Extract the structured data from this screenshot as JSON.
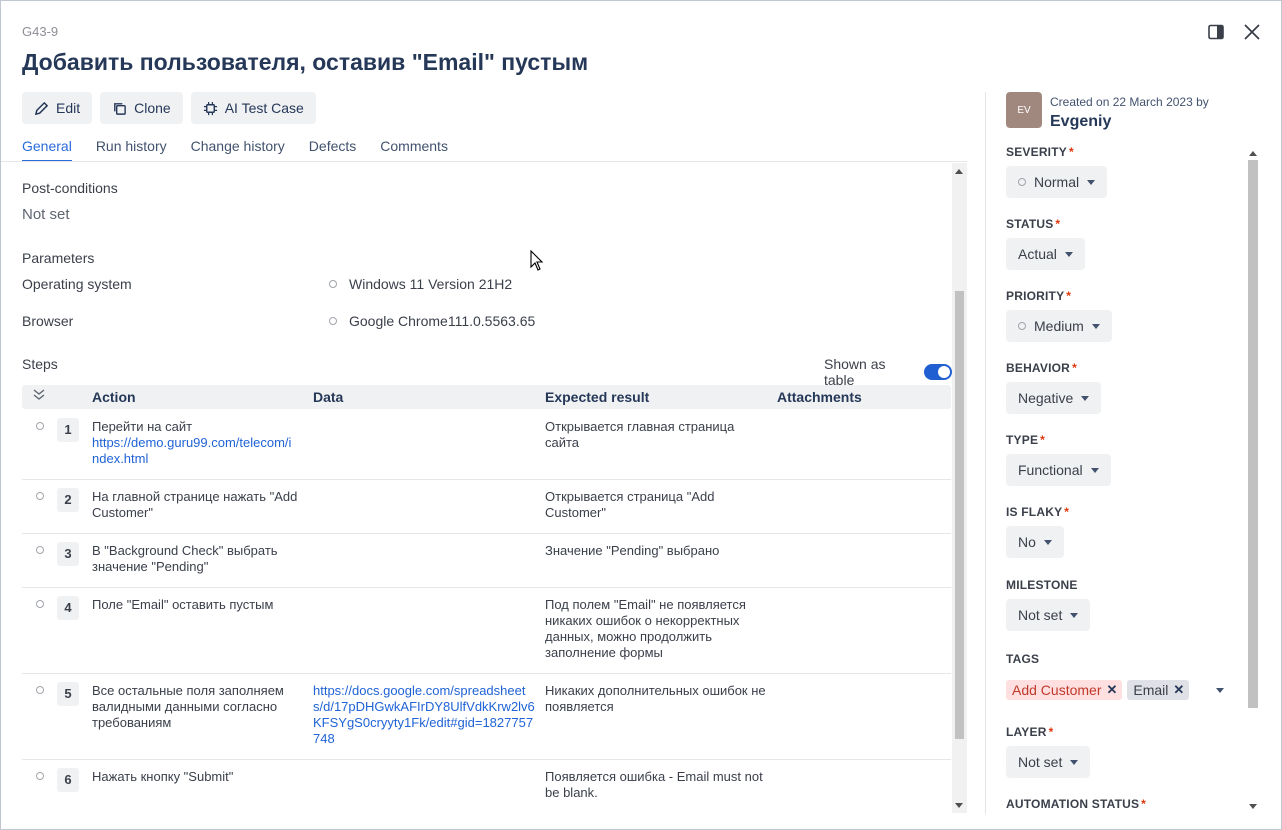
{
  "header": {
    "case_key": "G43-9",
    "title": "Добавить пользователя, оставив \"Email\" пустым",
    "icons": [
      "panel-toggle-icon",
      "close-icon"
    ]
  },
  "toolbar": {
    "edit_label": "Edit",
    "clone_label": "Clone",
    "ai_label": "AI Test Case"
  },
  "tabs": [
    {
      "label": "General",
      "active": true
    },
    {
      "label": "Run history",
      "active": false
    },
    {
      "label": "Change history",
      "active": false
    },
    {
      "label": "Defects",
      "active": false
    },
    {
      "label": "Comments",
      "active": false
    }
  ],
  "main": {
    "postconditions_label": "Post-conditions",
    "postconditions_value": "Not set",
    "parameters_label": "Parameters",
    "parameters": [
      {
        "name": "Operating system",
        "value": "Windows 11 Version 21H2"
      },
      {
        "name": "Browser",
        "value": "Google Chrome111.0.5563.65"
      }
    ],
    "steps_label": "Steps",
    "shown_as_table_label": "Shown as table",
    "shown_as_table": true,
    "columns": {
      "action": "Action",
      "data": "Data",
      "expected": "Expected result",
      "attachments": "Attachments"
    },
    "steps": [
      {
        "num": "1",
        "action": "Перейти на сайт",
        "action_link": "https://demo.guru99.com/telecom/index.html",
        "data": "",
        "expected": "Открывается главная страница сайта"
      },
      {
        "num": "2",
        "action": "На главной странице нажать \"Add Customer\"",
        "action_link": "",
        "data": "",
        "expected": "Открывается страница \"Add Customer\""
      },
      {
        "num": "3",
        "action": "В \"Background Check\" выбрать значение \"Pending\"",
        "action_link": "",
        "data": "",
        "expected": "Значение \"Pending\" выбрано"
      },
      {
        "num": "4",
        "action": "Поле \"Email\" оставить пустым",
        "action_link": "",
        "data": "",
        "expected": "Под полем \"Email\" не появляется никаких ошибок о некорректных данных, можно продолжить заполнение формы"
      },
      {
        "num": "5",
        "action": "Все остальные поля заполняем валидными данными согласно требованиям",
        "action_link": "",
        "data": "https://docs.google.com/spreadsheets/d/17pDHGwkAFIrDY8UlfVdkKrw2lv6KFSYgS0cryyty1Fk/edit#gid=1827757748",
        "expected": "Никаких дополнительных ошибок не появляется"
      },
      {
        "num": "6",
        "action": "Нажать кнопку \"Submit\"",
        "action_link": "",
        "data": "",
        "expected": "Появляется ошибка - Email must not be blank."
      }
    ]
  },
  "sidebar": {
    "avatar_initials": "EV",
    "created_text": "Created on 22 March 2023 by",
    "creator": "Evgeniy",
    "fields": [
      {
        "label": "SEVERITY",
        "value": "Normal",
        "required": true
      },
      {
        "label": "STATUS",
        "value": "Actual",
        "required": true
      },
      {
        "label": "PRIORITY",
        "value": "Medium",
        "required": true
      },
      {
        "label": "BEHAVIOR",
        "value": "Negative",
        "required": true
      },
      {
        "label": "TYPE",
        "value": "Functional",
        "required": true
      },
      {
        "label": "IS FLAKY",
        "value": "No",
        "required": true
      },
      {
        "label": "MILESTONE",
        "value": "Not set",
        "required": false
      }
    ],
    "tags_label": "TAGS",
    "tags": [
      "Add Customer",
      "Email"
    ],
    "layer_label": "LAYER",
    "layer_value": "Not set",
    "automation_label": "AUTOMATION STATUS",
    "required_mark": "*"
  },
  "colors": {
    "accent": "#2b6cdb",
    "link": "#1f63d6",
    "required": "#de350b",
    "tag_red_bg": "#ffdfdf",
    "avatar_bg": "#a1887f"
  }
}
